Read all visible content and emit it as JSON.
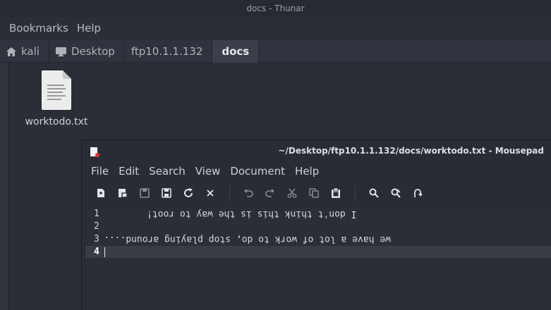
{
  "thunar": {
    "title": "docs - Thunar",
    "menu": [
      "Bookmarks",
      "Help"
    ],
    "breadcrumbs": [
      {
        "label": "kali",
        "icon": "home-icon"
      },
      {
        "label": "Desktop",
        "icon": "desktop-icon"
      },
      {
        "label": "ftp10.1.1.132",
        "icon": ""
      },
      {
        "label": "docs",
        "icon": "",
        "active": true
      }
    ],
    "files": [
      {
        "name": "worktodo.txt",
        "icon": "text-file-icon"
      }
    ]
  },
  "mousepad": {
    "title": "~/Desktop/ftp10.1.1.132/docs/worktodo.txt - Mousepad",
    "menu": [
      "File",
      "Edit",
      "Search",
      "View",
      "Document",
      "Help"
    ],
    "toolbar": [
      "new-document-icon",
      "new-window-icon",
      "save-icon",
      "save-as-icon",
      "reload-icon",
      "close-icon",
      "undo-icon",
      "redo-icon",
      "cut-icon",
      "copy-icon",
      "paste-icon",
      "find-icon",
      "find-replace-icon",
      "go-to-line-icon"
    ],
    "lines": [
      {
        "number": "1",
        "text": "i pou,ʇ ʇɥıuʞ ʇɥıs ıs ʇɥǝ ʍɐʎ ʇo ɹooʇ¡"
      },
      {
        "number": "2",
        "text": ""
      },
      {
        "number": "3",
        "text": "....punoɹɐ buıʎɐld doʇs 'op oʇ ʞɹoʍ ɟo ʇol ɐ ǝʌɐɥ ǝʍ"
      },
      {
        "number": "4",
        "text": ""
      }
    ],
    "displayed": {
      "line1": "I don't think this is the way to root!",
      "line3": "we have a lot of work to do, stop playing around...."
    }
  }
}
